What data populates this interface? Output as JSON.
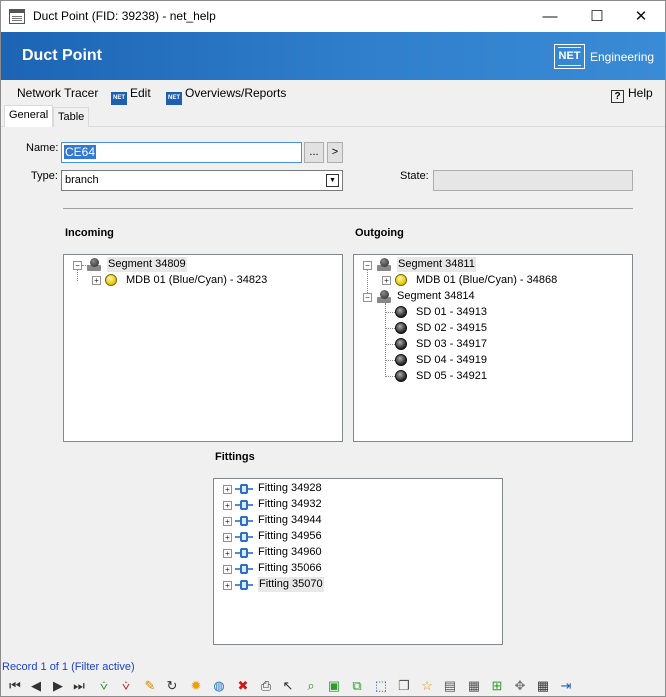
{
  "window": {
    "title": "Duct Point (FID: 39238) - net_help",
    "minimize_glyph": "—",
    "maximize_glyph": "☐",
    "close_glyph": "✕"
  },
  "banner": {
    "title": "Duct Point",
    "logo_text": "NET",
    "brand": "Engineering",
    "colors": {
      "start": "#1d64b4",
      "end": "#3a8bd6"
    }
  },
  "menu": {
    "network_tracer": "Network Tracer",
    "edit": "Edit",
    "overviews": "Overviews/Reports",
    "help": "Help",
    "help_glyph": "?",
    "net_badge": "NET"
  },
  "tabs": [
    "General",
    "Table"
  ],
  "form": {
    "name_label": "Name:",
    "name_value": "CE64",
    "browse_label": "...",
    "go_label": ">",
    "type_label": "Type:",
    "type_value": "branch",
    "type_arrow": "▼",
    "state_label": "State:",
    "state_value": ""
  },
  "incoming": {
    "title": "Incoming",
    "segment": "Segment 34809",
    "cable": "MDB 01 (Blue/Cyan) - 34823"
  },
  "outgoing": {
    "title": "Outgoing",
    "segment1": "Segment 34811",
    "cable1": "MDB 01 (Blue/Cyan) - 34868",
    "segment2": "Segment 34814",
    "subducts": [
      "SD 01 - 34913",
      "SD 02 - 34915",
      "SD 03 - 34917",
      "SD 04 - 34919",
      "SD 05 - 34921"
    ]
  },
  "fittings": {
    "title": "Fittings",
    "items": [
      "Fitting 34928",
      "Fitting 34932",
      "Fitting 34944",
      "Fitting 34956",
      "Fitting 34960",
      "Fitting 35066",
      "Fitting 35070"
    ]
  },
  "tree_glyphs": {
    "expand": "+",
    "collapse": "−"
  },
  "status": {
    "text": "Record 1 of 1 (Filter active)"
  },
  "toolbar": [
    {
      "name": "first-record-icon",
      "glyph": "⏮",
      "color": "#333333"
    },
    {
      "name": "previous-record-icon",
      "glyph": "◀",
      "color": "#333333"
    },
    {
      "name": "next-record-icon",
      "glyph": "▶",
      "color": "#333333"
    },
    {
      "name": "last-record-icon",
      "glyph": "⏭",
      "color": "#333333"
    },
    {
      "name": "add-filter-icon",
      "glyph": "⩒",
      "color": "#2e8b2e"
    },
    {
      "name": "remove-filter-icon",
      "glyph": "⩒",
      "color": "#c02020"
    },
    {
      "name": "edit-pencil-icon",
      "glyph": "✎",
      "color": "#d08a00"
    },
    {
      "name": "refresh-icon",
      "glyph": "↻",
      "color": "#333333"
    },
    {
      "name": "highlight-icon",
      "glyph": "✹",
      "color": "#f0a000"
    },
    {
      "name": "globe-icon",
      "glyph": "◍",
      "color": "#1e70c0"
    },
    {
      "name": "delete-icon",
      "glyph": "✖",
      "color": "#d01818"
    },
    {
      "name": "print-icon",
      "glyph": "⎙",
      "color": "#333333"
    },
    {
      "name": "select-icon",
      "glyph": "↖",
      "color": "#333333"
    },
    {
      "name": "zoom-to-icon",
      "glyph": "⌕",
      "color": "#2e8b2e"
    },
    {
      "name": "layer-green-icon",
      "glyph": "▣",
      "color": "#2e9b2e"
    },
    {
      "name": "copy-layer-icon",
      "glyph": "⧉",
      "color": "#2e9b2e"
    },
    {
      "name": "select-frame-icon",
      "glyph": "⬚",
      "color": "#1e5fb0"
    },
    {
      "name": "duplicate-icon",
      "glyph": "❐",
      "color": "#555555"
    },
    {
      "name": "new-document-icon",
      "glyph": "☆",
      "color": "#e09000"
    },
    {
      "name": "document-image-icon",
      "glyph": "▤",
      "color": "#555555"
    },
    {
      "name": "document-chart-icon",
      "glyph": "▦",
      "color": "#555555"
    },
    {
      "name": "add-document-icon",
      "glyph": "⊞",
      "color": "#2e9b2e"
    },
    {
      "name": "network-icon",
      "glyph": "✥",
      "color": "#777777"
    },
    {
      "name": "table-icon",
      "glyph": "▦",
      "color": "#333333"
    },
    {
      "name": "exit-icon",
      "glyph": "⇥",
      "color": "#1e5fb0"
    }
  ]
}
